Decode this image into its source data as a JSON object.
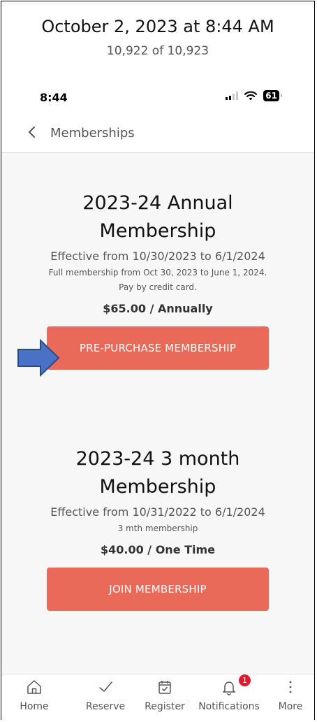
{
  "photo_header": {
    "date": "October 2, 2023 at 8:44 AM",
    "count": "10,922 of 10,923"
  },
  "status_bar": {
    "time": "8:44",
    "battery": "61",
    "signal_icon": "cellular-signal-icon",
    "wifi_icon": "wifi-icon"
  },
  "nav": {
    "back_icon": "chevron-left-icon",
    "title": "Memberships"
  },
  "memberships": [
    {
      "title_line1": "2023-24 Annual",
      "title_line2": "Membership",
      "effective": "Effective from 10/30/2023 to 6/1/2024",
      "description_line1": "Full membership from Oct 30, 2023 to June 1, 2024.",
      "description_line2": "Pay by credit card.",
      "price": "$65.00 / Annually",
      "button_label": "PRE-PURCHASE MEMBERSHIP"
    },
    {
      "title_line1": "2023-24 3 month",
      "title_line2": "Membership",
      "effective": "Effective from 10/31/2022 to 6/1/2024",
      "description_line1": "3 mth membership",
      "price": "$40.00 / One Time",
      "button_label": "JOIN MEMBERSHIP"
    }
  ],
  "annotation": {
    "arrow_icon": "right-arrow-icon",
    "arrow_color": "#4a72c4"
  },
  "tabs": [
    {
      "label": "Home",
      "icon": "home-icon"
    },
    {
      "label": "Reserve",
      "icon": "checkmark-icon"
    },
    {
      "label": "Register",
      "icon": "calendar-check-icon"
    },
    {
      "label": "Notifications",
      "icon": "bell-icon",
      "badge": "1"
    },
    {
      "label": "More",
      "icon": "more-vertical-icon"
    }
  ],
  "colors": {
    "accent": "#ea6a5a",
    "badge": "#e0192f"
  }
}
